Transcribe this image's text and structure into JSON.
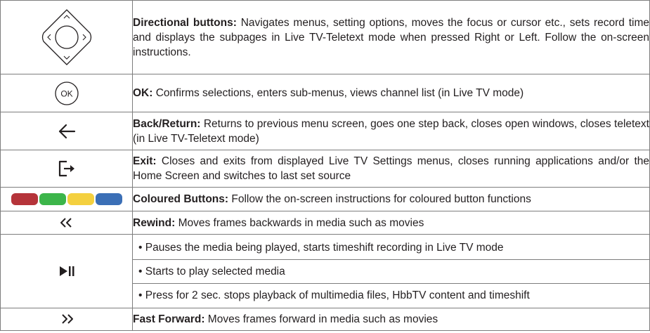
{
  "rows": [
    {
      "icon": "directional-pad-icon",
      "title": "Directional buttons:",
      "text": " Navigates menus, setting options, moves the focus or cursor etc., sets record time and displays the subpages in Live TV-Teletext mode when pressed Right or Left. Follow the on-screen instructions."
    },
    {
      "icon": "ok-button-icon",
      "icon_label": "OK",
      "title": "OK:",
      "text": " Confirms selections, enters sub-menus, views channel list (in Live TV mode)"
    },
    {
      "icon": "back-arrow-icon",
      "title": "Back/Return:",
      "text": " Returns to previous menu screen, goes one step back, closes open windows, closes teletext (in Live TV-Teletext mode)"
    },
    {
      "icon": "exit-icon",
      "title": "Exit:",
      "text": " Closes and exits from displayed Live TV Settings menus, closes running applications and/or the Home Screen and switches to last set source"
    },
    {
      "icon": "coloured-buttons-icon",
      "colors": [
        "#b5343a",
        "#3cb54a",
        "#f4d03f",
        "#3b6fb6"
      ],
      "title": "Coloured Buttons:",
      "text": " Follow the on-screen instructions for coloured button functions"
    },
    {
      "icon": "rewind-icon",
      "title": "Rewind:",
      "text": " Moves frames backwards in media such as movies"
    },
    {
      "icon": "play-pause-icon",
      "bullets": [
        "• Pauses the media being played, starts timeshift recording in Live TV mode",
        "• Starts to play selected media",
        "• Press for 2 sec. stops playback of multimedia files, HbbTV content and timeshift"
      ]
    },
    {
      "icon": "fast-forward-icon",
      "title": "Fast Forward:",
      "text": " Moves frames forward in media such as movies"
    }
  ]
}
